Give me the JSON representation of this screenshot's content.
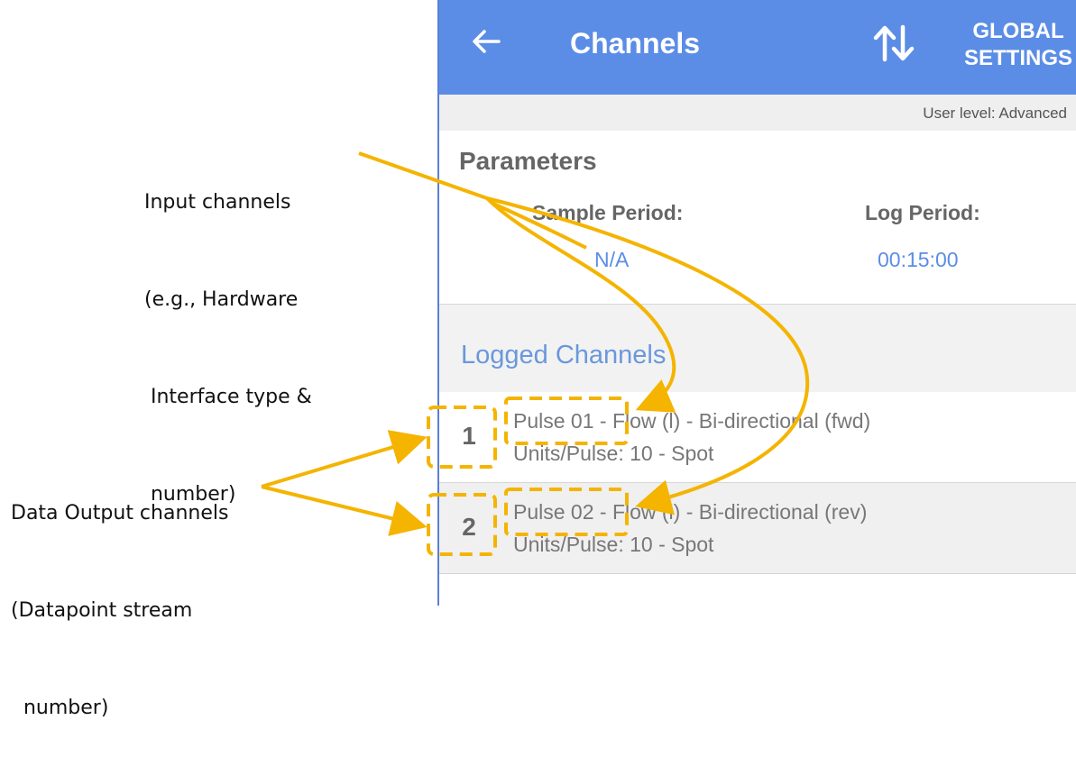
{
  "appbar": {
    "title": "Channels",
    "global_settings_line1": "GLOBAL",
    "global_settings_line2": "SETTINGS",
    "back_icon": "arrow-left-icon",
    "sort_icon": "sort-up-down-icon",
    "color": "#5b8de6"
  },
  "user_level": "User level: Advanced",
  "parameters": {
    "title": "Parameters",
    "sample_period_label": "Sample Period:",
    "sample_period_value": "N/A",
    "log_period_label": "Log Period:",
    "log_period_value": "00:15:00"
  },
  "logged_channels": {
    "title": "Logged Channels",
    "items": [
      {
        "number": "1",
        "name": "Pulse 01 - Flow (l) - Bi-directional (fwd)",
        "detail": "Units/Pulse: 10 - Spot"
      },
      {
        "number": "2",
        "name": "Pulse 02 - Flow (l) - Bi-directional (rev)",
        "detail": "Units/Pulse: 10 - Spot"
      }
    ]
  },
  "annotations": {
    "input_channels": [
      "Input channels",
      "(e.g., Hardware",
      " Interface type &",
      " number)"
    ],
    "data_output_channels": [
      "Data Output channels",
      "(Datapoint stream",
      "  number)"
    ],
    "highlight_color": "#f4b400"
  }
}
